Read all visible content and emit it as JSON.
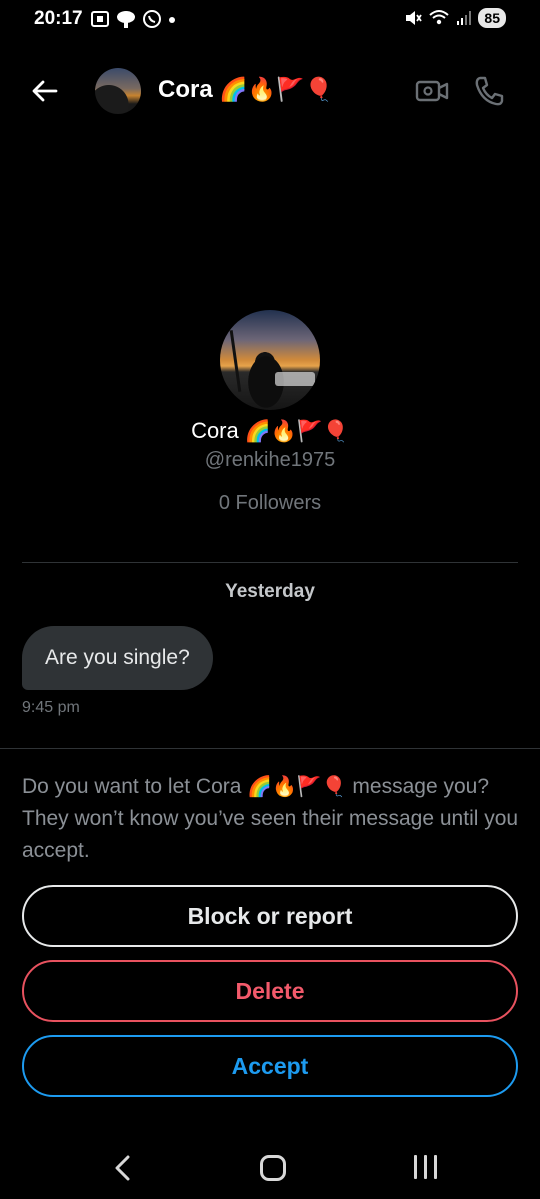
{
  "status_bar": {
    "time": "20:17",
    "battery": "85",
    "left_icons": [
      "screenshot-icon",
      "weather-icon",
      "whatsapp-icon",
      "dot-icon"
    ],
    "right_icons": [
      "mute-icon",
      "wifi-icon",
      "signal-icon",
      "battery-icon"
    ]
  },
  "header": {
    "name": "Cora",
    "name_emojis": "🌈🔥🚩🎈",
    "icons": [
      "back-arrow-icon",
      "video-icon",
      "phone-icon"
    ]
  },
  "profile": {
    "name": "Cora",
    "name_emojis": "🌈🔥🚩🎈",
    "handle": "@renkihe1975",
    "followers": "0 Followers"
  },
  "conversation": {
    "date_separator": "Yesterday",
    "messages": [
      {
        "text": "Are you single?",
        "time": "9:45 pm"
      }
    ]
  },
  "request": {
    "text_before": "Do you want to let Cora ",
    "text_emojis": "🌈🔥🚩🎈",
    "text_after": " message you? They won’t know you’ve seen their message until you accept.",
    "block_label": "Block or report",
    "delete_label": "Delete",
    "accept_label": "Accept"
  },
  "colors": {
    "background": "#000000",
    "accept": "#1d9bf0",
    "delete": "#e8525f",
    "bubble": "#2f3336",
    "muted_text": "#71767b"
  }
}
